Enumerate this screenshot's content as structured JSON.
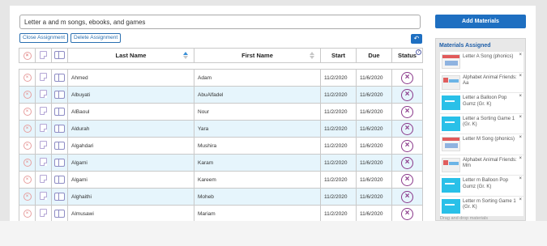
{
  "assignment": {
    "title_value": "Letter a and m songs, ebooks, and games",
    "close_label": "Close Assignment",
    "delete_label": "Delete Assignment",
    "back_icon": "↶"
  },
  "table": {
    "headers": {
      "last_name": "Last Name",
      "first_name": "First Name",
      "start": "Start",
      "due": "Due",
      "status": "Status",
      "help": "?"
    },
    "rows": [
      {
        "last": "Ahmed",
        "first": "Adam",
        "start": "11/2/2020",
        "due": "11/6/2020"
      },
      {
        "last": "Albuyati",
        "first": "AbuAlfadel",
        "start": "11/2/2020",
        "due": "11/6/2020"
      },
      {
        "last": "AlBaoul",
        "first": "Nour",
        "start": "11/2/2020",
        "due": "11/6/2020"
      },
      {
        "last": "Aldurah",
        "first": "Yara",
        "start": "11/2/2020",
        "due": "11/6/2020"
      },
      {
        "last": "Algahdari",
        "first": "Mushira",
        "start": "11/2/2020",
        "due": "11/6/2020"
      },
      {
        "last": "Algami",
        "first": "Karam",
        "start": "11/2/2020",
        "due": "11/6/2020"
      },
      {
        "last": "Algami",
        "first": "Kareem",
        "start": "11/2/2020",
        "due": "11/6/2020"
      },
      {
        "last": "Alghaithi",
        "first": "Moheb",
        "start": "11/2/2020",
        "due": "11/6/2020"
      },
      {
        "last": "Almusawi",
        "first": "Mariam",
        "start": "11/2/2020",
        "due": "11/6/2020"
      }
    ],
    "remove_symbol": "×",
    "row_icon_x": "×"
  },
  "sidebar": {
    "add_label": "Add Materials",
    "materials_title": "Materials Assigned",
    "items": [
      {
        "text": "Letter A Song (phonics)",
        "thumb": "strip"
      },
      {
        "text": "Alphabet Animal Friends: Aa",
        "thumb": "alpha"
      },
      {
        "text": "Letter a Balloon Pop Gumz (Gr. K)",
        "thumb": "cyan"
      },
      {
        "text": "Letter a Sorting Game 1 (Gr. K)",
        "thumb": "cyan"
      },
      {
        "text": "Letter M Song (phonics)",
        "thumb": "strip"
      },
      {
        "text": "Alphabet Animal Friends: Mm",
        "thumb": "alpha"
      },
      {
        "text": "Letter m Balloon Pop Gumz (Gr. K)",
        "thumb": "cyan"
      },
      {
        "text": "Letter m Sorting Game 1 (Gr. K)",
        "thumb": "cyan"
      }
    ],
    "remove_label": "×",
    "drag_hint": "Drag and drop materials"
  },
  "colors": {
    "accent": "#1e6fc1",
    "row_alt": "#e6f5fc",
    "status_x": "#8b3a8b"
  }
}
